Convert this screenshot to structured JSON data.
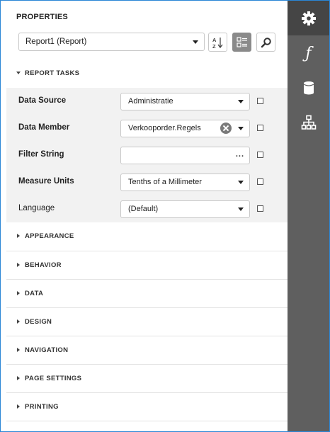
{
  "panel": {
    "title": "PROPERTIES",
    "object_selector": {
      "value": "Report1 (Report)"
    },
    "toolbar": {
      "sort_icon": "sort-alphabetical-icon",
      "categories_icon": "categories-icon",
      "search_icon": "search-icon"
    }
  },
  "report_tasks": {
    "header": "REPORT TASKS",
    "expanded": true,
    "rows": [
      {
        "label": "Data Source",
        "value": "Administratie",
        "editor": "dropdown",
        "bold": true
      },
      {
        "label": "Data Member",
        "value": "Verkooporder.Regels",
        "editor": "dropdown-clear",
        "bold": true
      },
      {
        "label": "Filter String",
        "value": "",
        "editor": "ellipsis",
        "ellipsis": "...",
        "bold": true
      },
      {
        "label": "Measure Units",
        "value": "Tenths of a Millimeter",
        "editor": "dropdown",
        "bold": true
      },
      {
        "label": "Language",
        "value": "(Default)",
        "editor": "dropdown",
        "bold": false
      }
    ]
  },
  "sections": [
    "APPEARANCE",
    "BEHAVIOR",
    "DATA",
    "DESIGN",
    "NAVIGATION",
    "PAGE SETTINGS",
    "PRINTING"
  ],
  "sidebar": {
    "items": [
      {
        "icon": "gear-icon",
        "active": true
      },
      {
        "icon": "function-icon",
        "active": false,
        "glyph": "ƒ"
      },
      {
        "icon": "database-icon",
        "active": false
      },
      {
        "icon": "hierarchy-icon",
        "active": false
      }
    ]
  },
  "colors": {
    "window_border": "#2a86d6",
    "sidebar_bg": "#5f5f5f",
    "sidebar_active": "#454545",
    "tasks_bg": "#f2f2f2"
  }
}
